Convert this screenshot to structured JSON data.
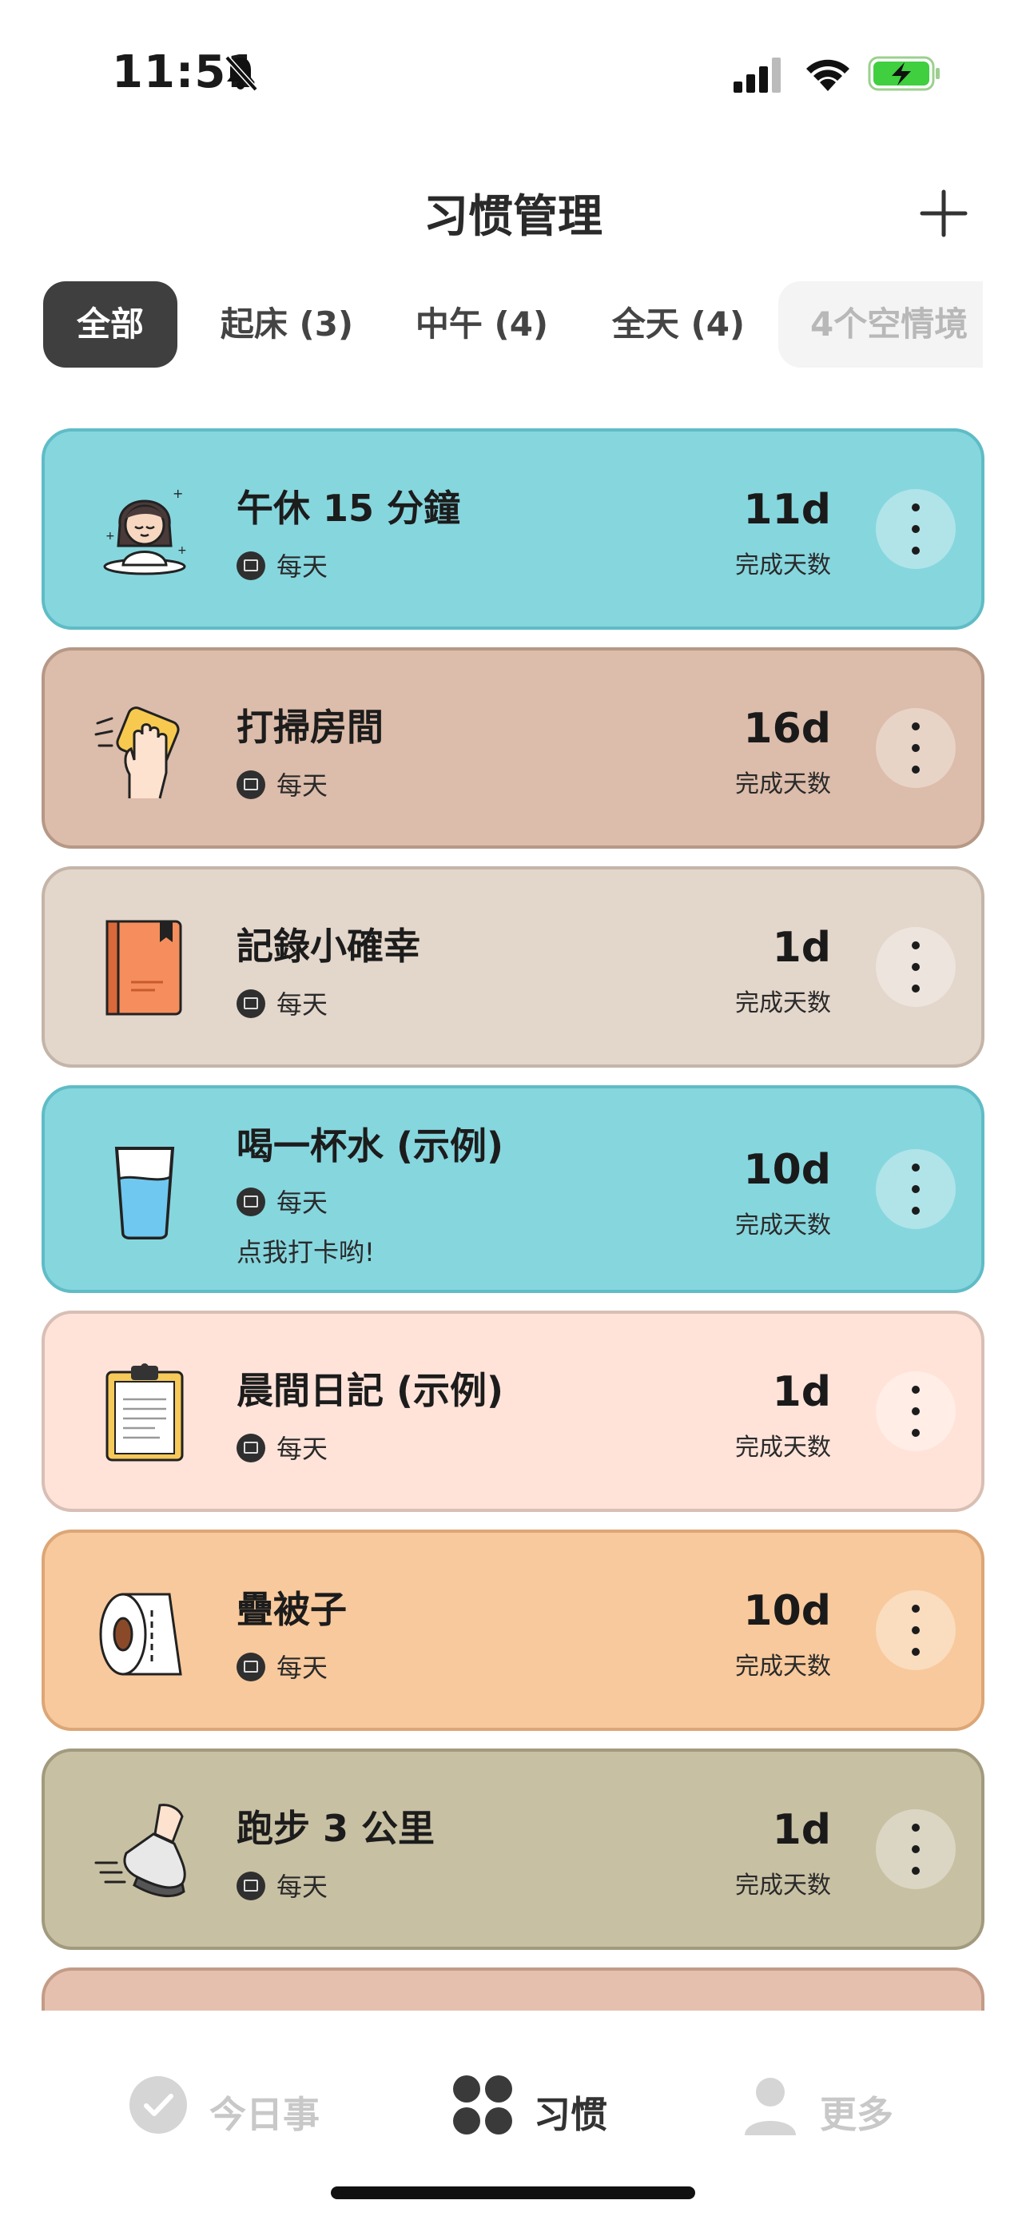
{
  "status_bar": {
    "time": "11:51",
    "icons": [
      "bell-muted-icon",
      "signal-icon",
      "wifi-icon",
      "battery-charging-icon"
    ]
  },
  "header": {
    "title": "习惯管理",
    "add_icon": "plus-icon"
  },
  "tabs": [
    {
      "label": "全部",
      "active": true
    },
    {
      "label": "起床 (3)",
      "active": false
    },
    {
      "label": "中午 (4)",
      "active": false
    },
    {
      "label": "全天 (4)",
      "active": false
    },
    {
      "label": "4个空情境",
      "active": false
    }
  ],
  "habits": [
    {
      "name": "午休 15 分鐘",
      "frequency": "每天",
      "note": "",
      "days": "11d",
      "days_label": "完成天数",
      "icon": "meditating-girl-icon",
      "bg": "#86d6de",
      "border": "#5fbcc6"
    },
    {
      "name": "打掃房間",
      "frequency": "每天",
      "note": "",
      "days": "16d",
      "days_label": "完成天数",
      "icon": "cleaning-hand-icon",
      "bg": "#dcbcaa",
      "border": "#b69886"
    },
    {
      "name": "記錄小確幸",
      "frequency": "每天",
      "note": "",
      "days": "1d",
      "days_label": "完成天数",
      "icon": "notebook-icon",
      "bg": "#e3d6cb",
      "border": "#c4b5a8"
    },
    {
      "name": "喝一杯水 (示例)",
      "frequency": "每天",
      "note": "点我打卡哟!",
      "days": "10d",
      "days_label": "完成天数",
      "icon": "water-glass-icon",
      "bg": "#86d6de",
      "border": "#5fbcc6"
    },
    {
      "name": "晨間日記 (示例)",
      "frequency": "每天",
      "note": "",
      "days": "1d",
      "days_label": "完成天数",
      "icon": "clipboard-icon",
      "bg": "#ffe3d9",
      "border": "#d8bfb5"
    },
    {
      "name": "疊被子",
      "frequency": "每天",
      "note": "",
      "days": "10d",
      "days_label": "完成天数",
      "icon": "toilet-roll-icon",
      "bg": "#f8c99c",
      "border": "#dca676"
    },
    {
      "name": "跑步 3 公里",
      "frequency": "每天",
      "note": "",
      "days": "1d",
      "days_label": "完成天数",
      "icon": "running-shoe-icon",
      "bg": "#c8c0a3",
      "border": "#a29a7e"
    },
    {
      "name": "",
      "frequency": "",
      "note": "",
      "days": "",
      "days_label": "",
      "icon": "",
      "bg": "#e6c0ae",
      "border": "#c39c88"
    }
  ],
  "bottom_nav": [
    {
      "label": "今日事",
      "icon": "check-circle-icon",
      "active": false
    },
    {
      "label": "习惯",
      "icon": "four-dots-icon",
      "active": true
    },
    {
      "label": "更多",
      "icon": "person-icon",
      "active": false
    }
  ]
}
